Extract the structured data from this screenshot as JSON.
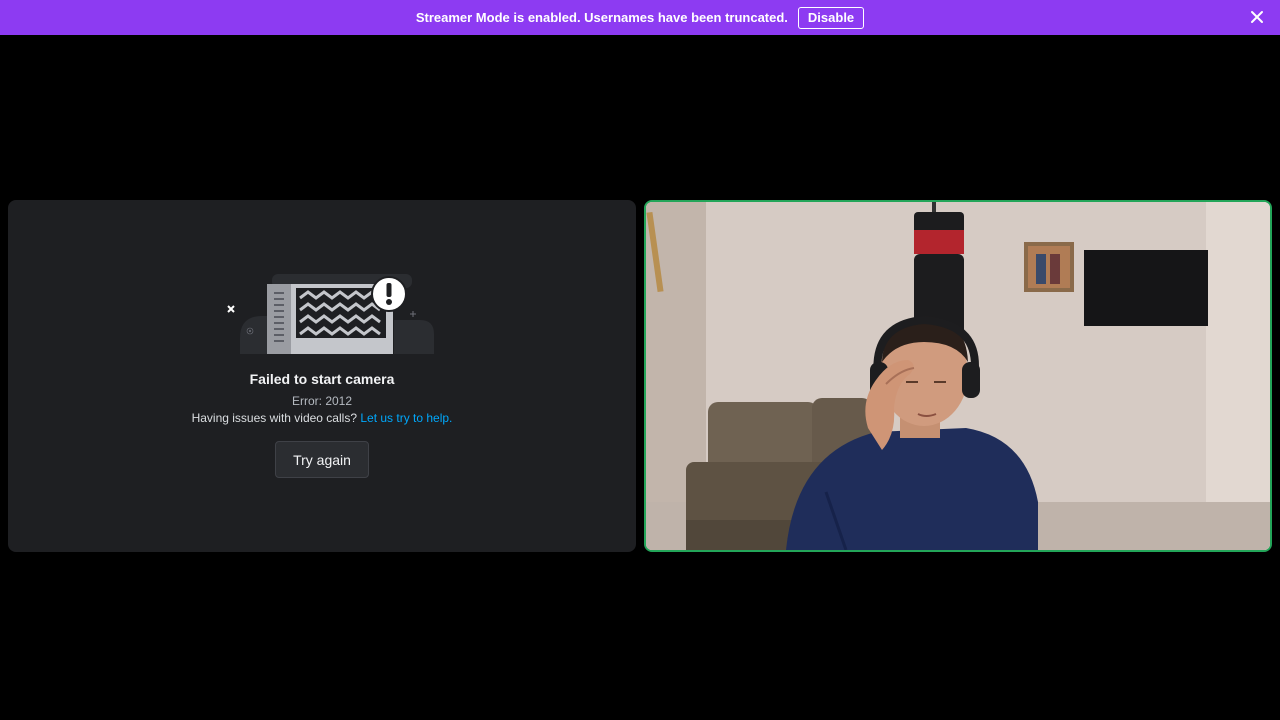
{
  "banner": {
    "message": "Streamer Mode is enabled. Usernames have been truncated.",
    "disable_label": "Disable",
    "color": "#8d3bf2"
  },
  "camera_error": {
    "title": "Failed to start camera",
    "error_code": "Error: 2012",
    "help_prefix": "Having issues with video calls?",
    "help_link": "Let us try to help.",
    "retry_label": "Try again"
  },
  "video_tile": {
    "speaking_border_color": "#23a559"
  }
}
